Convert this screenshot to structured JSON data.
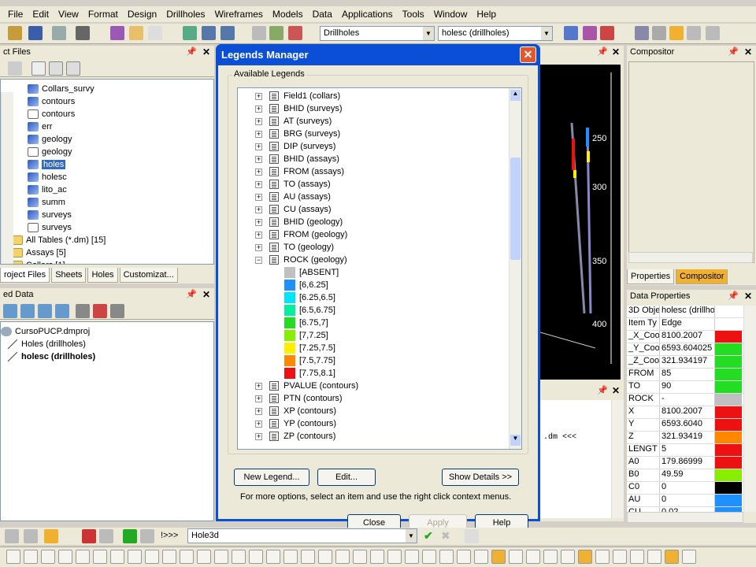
{
  "menu": [
    "File",
    "Edit",
    "View",
    "Format",
    "Design",
    "Drillholes",
    "Wireframes",
    "Models",
    "Data",
    "Applications",
    "Tools",
    "Window",
    "Help"
  ],
  "toolbar": {
    "combo1": "Drillholes",
    "combo2": "holesc (drillholes)"
  },
  "project_files": {
    "title": "ct Files",
    "items": [
      {
        "label": "Collars_survy",
        "icon": "layer-icon"
      },
      {
        "label": "contours",
        "icon": "layer-icon"
      },
      {
        "label": "contours",
        "icon": "doc-icon"
      },
      {
        "label": "err",
        "icon": "layer-icon"
      },
      {
        "label": "geology",
        "icon": "layer-icon"
      },
      {
        "label": "geology",
        "icon": "doc-icon"
      },
      {
        "label": "holes",
        "icon": "layer-icon"
      },
      {
        "label": "holesc",
        "icon": "layer-icon"
      },
      {
        "label": "lito_ac",
        "icon": "layer-icon"
      },
      {
        "label": "summ",
        "icon": "layer-icon"
      },
      {
        "label": "surveys",
        "icon": "layer-icon"
      },
      {
        "label": "surveys",
        "icon": "doc-icon"
      }
    ],
    "folders": [
      "All Tables (*.dm) [15]",
      "Assays [5]",
      "Collars [1]"
    ],
    "tabs": [
      "roject Files",
      "Sheets",
      "Holes",
      "Customizat..."
    ]
  },
  "loaded_data": {
    "title": "ed Data",
    "project": "CursoPUCP.dmproj",
    "items": [
      "Holes (drillholes)",
      "holesc (drillholes)"
    ]
  },
  "dialog": {
    "title": "Legends Manager",
    "close": "✕",
    "group_label": "Available Legends",
    "legends_top": [
      "Field1 (collars)",
      "BHID (surveys)",
      "AT (surveys)",
      "BRG (surveys)",
      "DIP (surveys)",
      "BHID (assays)",
      "FROM (assays)",
      "TO (assays)",
      "AU (assays)",
      "CU (assays)",
      "BHID (geology)",
      "FROM (geology)",
      "TO (geology)"
    ],
    "expanded": "ROCK (geology)",
    "rock_items": [
      {
        "label": "[ABSENT]",
        "color": "#c0c0c0"
      },
      {
        "label": "[6,6.25]",
        "color": "#1e90ff"
      },
      {
        "label": "[6.25,6.5]",
        "color": "#00e5ff"
      },
      {
        "label": "[6.5,6.75]",
        "color": "#00f0a0"
      },
      {
        "label": "[6.75,7]",
        "color": "#22dd22"
      },
      {
        "label": "[7,7.25]",
        "color": "#88ee00"
      },
      {
        "label": "[7.25,7.5]",
        "color": "#ffee00"
      },
      {
        "label": "[7.5,7.75]",
        "color": "#ff8800"
      },
      {
        "label": "[7.75,8.1]",
        "color": "#ee1111"
      }
    ],
    "legends_bottom": [
      "PVALUE (contours)",
      "PTN (contours)",
      "XP (contours)",
      "YP (contours)",
      "ZP (contours)"
    ],
    "buttons": {
      "new": "New Legend...",
      "edit": "Edit...",
      "show": "Show Details >>",
      "close": "Close",
      "apply": "Apply",
      "help": "Help"
    },
    "hint": "For more options, select an item and use the right click context menus."
  },
  "view3d": {
    "ticks": [
      "250",
      "300",
      "350",
      "400"
    ],
    "output": ".dm <<<"
  },
  "compositor": {
    "title": "Compositor",
    "tabs": [
      "Properties",
      "Compositor"
    ]
  },
  "data_properties": {
    "title": "Data Properties",
    "rows": [
      {
        "k": "3D Obje",
        "v": "holesc (drillho",
        "c": "#ffffff"
      },
      {
        "k": "Item Ty",
        "v": "Edge",
        "c": "#ffffff"
      },
      {
        "k": "_X_Coo",
        "v": "8100.2007",
        "c": "#ee1111"
      },
      {
        "k": "_Y_Coo",
        "v": "6593.604025",
        "c": "#22dd22"
      },
      {
        "k": "_Z_Coo",
        "v": "321.934197",
        "c": "#22dd22"
      },
      {
        "k": "FROM",
        "v": "85",
        "c": "#22dd22"
      },
      {
        "k": "TO",
        "v": "90",
        "c": "#22dd22"
      },
      {
        "k": "ROCK",
        "v": "-",
        "c": "#c0c0c0"
      },
      {
        "k": "X",
        "v": "8100.2007",
        "c": "#ee1111"
      },
      {
        "k": "Y",
        "v": "6593.6040",
        "c": "#ee1111"
      },
      {
        "k": "Z",
        "v": "321.93419",
        "c": "#ff8800"
      },
      {
        "k": "LENGT",
        "v": "5",
        "c": "#ee1111"
      },
      {
        "k": "A0",
        "v": "179.86999",
        "c": "#ee1111"
      },
      {
        "k": "B0",
        "v": "49.59",
        "c": "#88ee00"
      },
      {
        "k": "C0",
        "v": "0",
        "c": "#000000"
      },
      {
        "k": "AU",
        "v": "0",
        "c": "#1e90ff"
      },
      {
        "k": "CU",
        "v": "0.02",
        "c": "#1e90ff"
      }
    ]
  },
  "command": {
    "prompt": "!>>>",
    "value": "Hole3d"
  }
}
